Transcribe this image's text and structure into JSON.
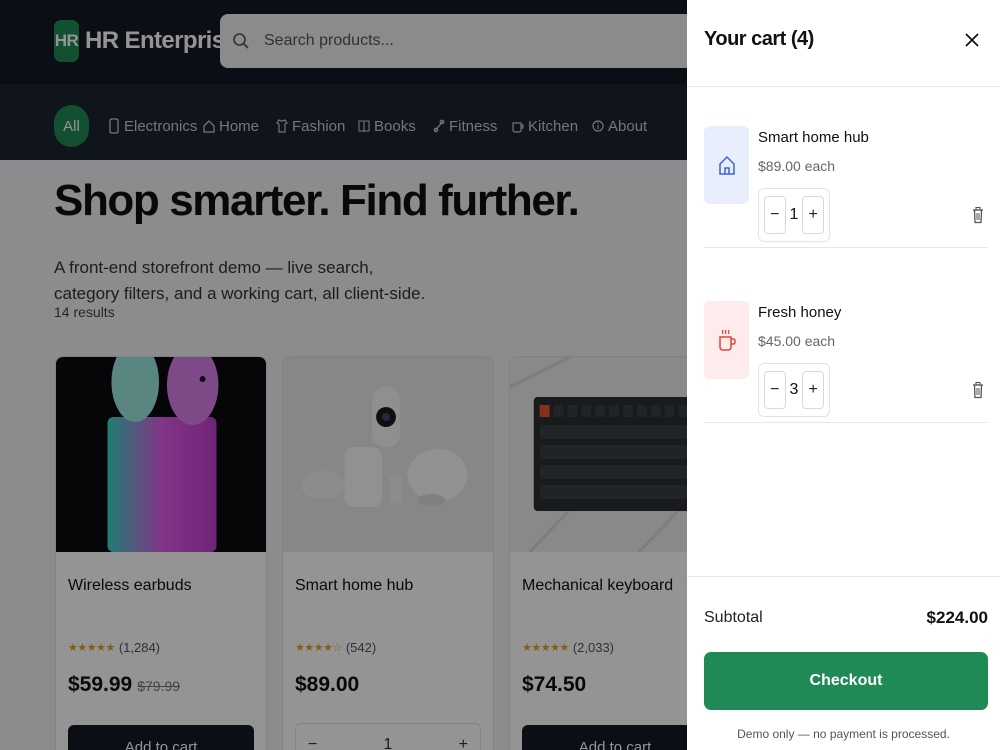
{
  "brand": {
    "mark": "HR",
    "name": "HR Enterprises",
    "accent": "#1f8a55"
  },
  "search": {
    "placeholder": "Search products..."
  },
  "categories": [
    "All",
    "Electronics",
    "Home",
    "Fashion",
    "Books",
    "Fitness",
    "Kitchen",
    "About"
  ],
  "hero": {
    "title": "Shop smarter. Find further.",
    "subtitle": "A front-end storefront demo — live search, category filters, and a working cart, all client-side.",
    "results": "14 results"
  },
  "products": [
    {
      "name": "Wireless earbuds",
      "stars": "★★★★★",
      "reviews": "(1,284)",
      "price": "$59.99",
      "old_price": "$79.99",
      "action": "Add to cart"
    },
    {
      "name": "Smart home hub",
      "stars": "★★★★☆",
      "reviews": "(542)",
      "price": "$89.00",
      "qty": "1",
      "minus": "−",
      "plus": "+"
    },
    {
      "name": "Mechanical keyboard",
      "stars": "★★★★★",
      "reviews": "(2,033)",
      "price": "$74.50",
      "action": "Add to cart"
    }
  ],
  "cart": {
    "title": "Your cart (4)",
    "items": [
      {
        "name": "Smart home hub",
        "each": "$89.00 each",
        "qty": "1",
        "icon": "house-icon"
      },
      {
        "name": "Fresh honey",
        "each": "$45.00 each",
        "qty": "3",
        "icon": "mug-icon"
      }
    ],
    "minus": "−",
    "plus": "+",
    "subtotal_label": "Subtotal",
    "subtotal": "$224.00",
    "checkout": "Checkout",
    "disclaimer": "Demo only — no payment is processed."
  }
}
